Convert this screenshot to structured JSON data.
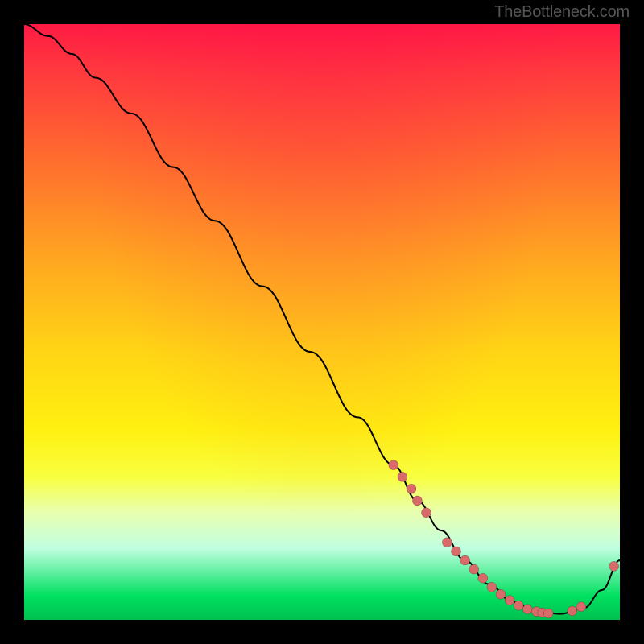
{
  "watermark": "TheBottleneck.com",
  "chart_data": {
    "type": "line",
    "title": "",
    "xlabel": "",
    "ylabel": "",
    "xlim": [
      0,
      100
    ],
    "ylim": [
      0,
      100
    ],
    "grid": false,
    "legend_position": "none",
    "series": [
      {
        "name": "curve",
        "x": [
          0,
          4,
          8,
          12,
          18,
          25,
          32,
          40,
          48,
          56,
          62,
          66,
          70,
          74,
          78,
          82,
          86,
          90,
          94,
          97,
          100
        ],
        "y": [
          100,
          98,
          95,
          91,
          85,
          76,
          67,
          56,
          45,
          34,
          26,
          20,
          15,
          10,
          6,
          3,
          1.5,
          1,
          2,
          5,
          10
        ]
      }
    ],
    "markers": {
      "name": "highlight-points",
      "x": [
        62,
        63.5,
        65,
        66,
        67.5,
        71,
        72.5,
        74,
        75.5,
        77,
        78.5,
        80,
        81.5,
        83,
        84.5,
        86,
        87,
        88,
        92,
        93.5,
        99
      ],
      "y": [
        26,
        24,
        22,
        20,
        18,
        13,
        11.5,
        10,
        8.5,
        7,
        5.5,
        4.3,
        3.3,
        2.4,
        1.8,
        1.4,
        1.2,
        1.1,
        1.5,
        2.2,
        9
      ]
    },
    "background_gradient": {
      "top": "#ff1a44",
      "mid": "#ffd515",
      "bottom": "#00c050"
    }
  }
}
